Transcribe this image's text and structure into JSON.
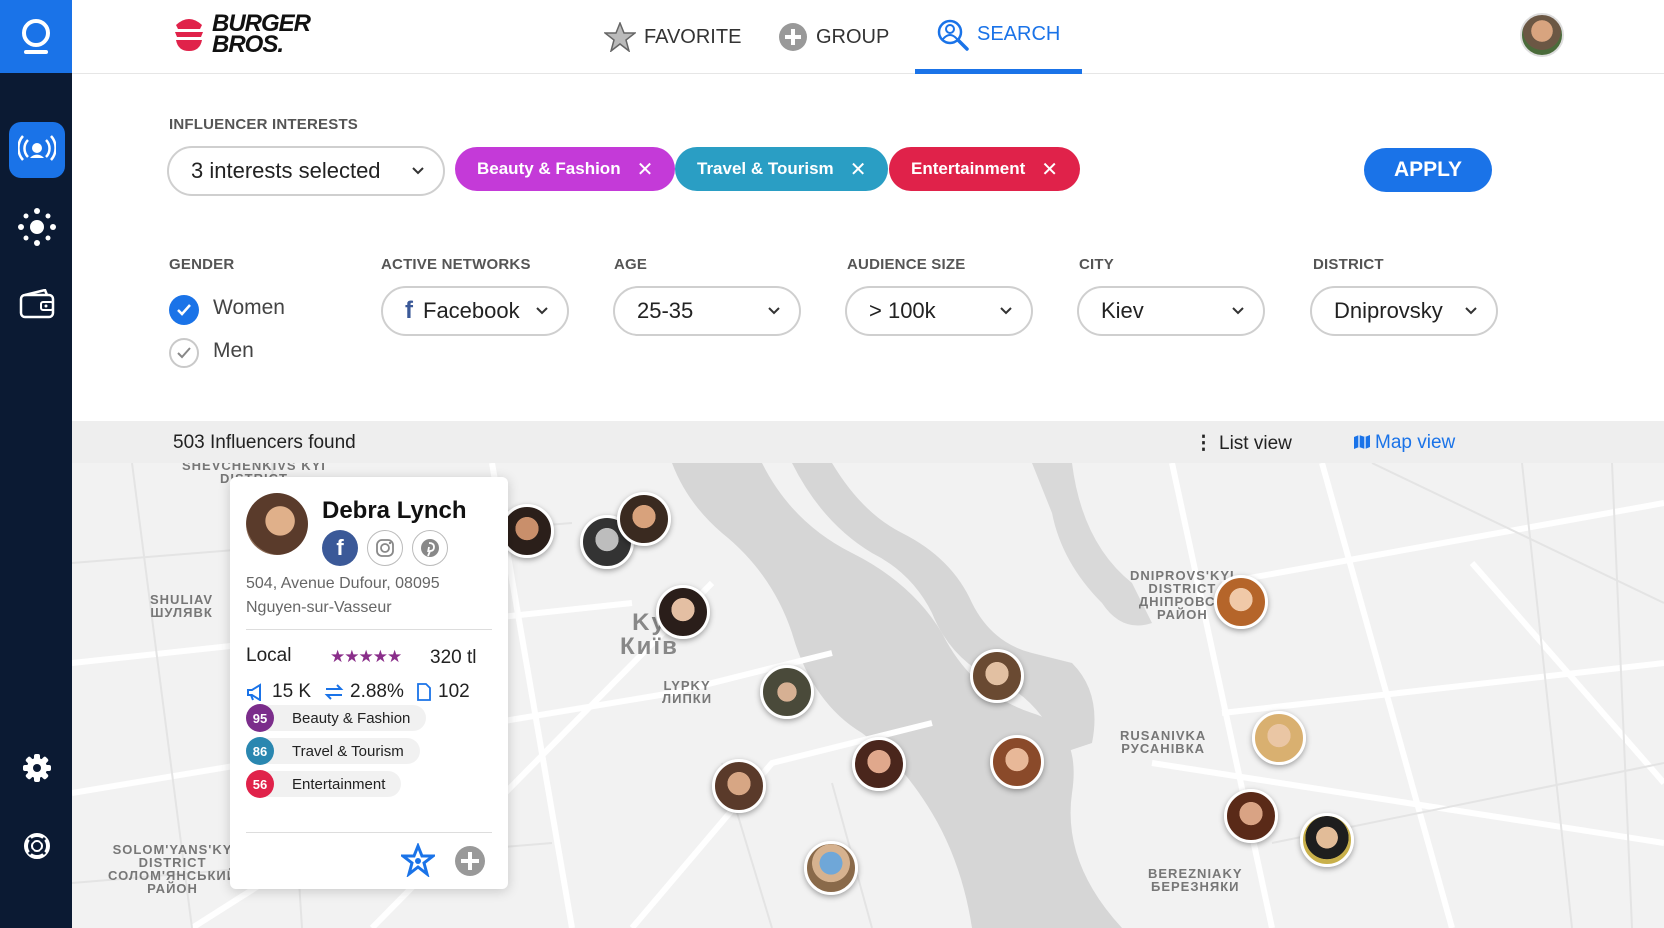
{
  "brand": {
    "line1": "BURGER",
    "line2": "BROS."
  },
  "nav": {
    "favorite": "FAVORITE",
    "group": "GROUP",
    "search": "SEARCH"
  },
  "filters": {
    "interests_label": "INFLUENCER INTERESTS",
    "interests_value": "3 interests selected",
    "chips": [
      {
        "label": "Beauty & Fashion",
        "color": "#c43ad8"
      },
      {
        "label": "Travel & Tourism",
        "color": "#2a9ec4"
      },
      {
        "label": "Entertainment",
        "color": "#e0224a"
      }
    ],
    "apply": "APPLY",
    "gender_label": "GENDER",
    "gender_women": "Women",
    "gender_men": "Men",
    "gender_women_checked": true,
    "gender_men_checked": false,
    "networks_label": "ACTIVE NETWORKS",
    "networks_value": "Facebook",
    "age_label": "AGE",
    "age_value": "25-35",
    "audience_label": "AUDIENCE SIZE",
    "audience_value": "> 100k",
    "city_label": "CITY",
    "city_value": "Kiev",
    "district_label": "DISTRICT",
    "district_value": "Dniprovsky"
  },
  "results": {
    "count": "503 Influencers found",
    "list_view": "List view",
    "map_view": "Map view"
  },
  "map": {
    "labels": {
      "shevchenkivskyi": "SHEVCHENKIVS KYI\nDISTRICT",
      "shuliav": "SHULIAV\nШУЛЯВК",
      "kyiv": "Ky\nКиїв",
      "lypky": "LYPKY\nЛИПКИ",
      "dniprovskyi": "DNIPROVS'KYI\nDISTRICT\nДНІПРОВСЬ\nРАЙОН",
      "rusanivka": "RUSANIVKA\nРУСАНІВКА",
      "berezniaky": "BEREZNIAKY\nБЕРЕЗНЯКИ",
      "solomianskyi": "SOLOM'YANS'KY\nDISTRICT\nСОЛОМ'ЯНСЬКИЙ\nРАЙОН"
    }
  },
  "card": {
    "name": "Debra Lynch",
    "address_line1": "504, Avenue Dufour, 08095",
    "address_line2": "Nguyen-sur-Vasseur",
    "type": "Local",
    "rating": 4.5,
    "stars": "★★★★★",
    "price": "320 tl",
    "reach": "15 K",
    "engagement": "2.88%",
    "posts": "102",
    "interests": [
      {
        "score": "95",
        "label": "Beauty & Fashion",
        "color": "#7b2d8b"
      },
      {
        "score": "86",
        "label": "Travel & Tourism",
        "color": "#2a87b0"
      },
      {
        "score": "56",
        "label": "Entertainment",
        "color": "#e0224a"
      }
    ]
  }
}
